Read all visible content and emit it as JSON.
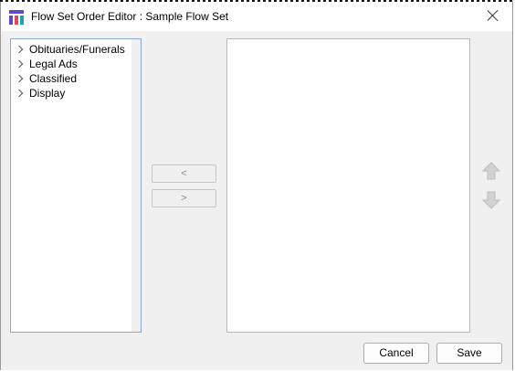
{
  "window": {
    "title": "Flow Set Order Editor : Sample Flow Set",
    "icon": "app-grid-icon"
  },
  "tree": {
    "items": [
      {
        "label": "Obituaries/Funerals",
        "icon": "chevron-right-icon"
      },
      {
        "label": "Legal Ads",
        "icon": "chevron-right-icon"
      },
      {
        "label": "Classified",
        "icon": "chevron-right-icon"
      },
      {
        "label": "Display",
        "icon": "chevron-right-icon"
      }
    ]
  },
  "transfer": {
    "remove_label": "<",
    "add_label": ">"
  },
  "order": {
    "move_up_icon": "arrow-up-icon",
    "move_down_icon": "arrow-down-icon"
  },
  "footer": {
    "cancel_label": "Cancel",
    "save_label": "Save"
  },
  "colors": {
    "tree_border": "#8fa7d0",
    "dialog_bg": "#f0f0f0",
    "icon_purple": "#5b4bc4",
    "icon_red": "#e2475f",
    "icon_teal": "#17a7a8"
  }
}
